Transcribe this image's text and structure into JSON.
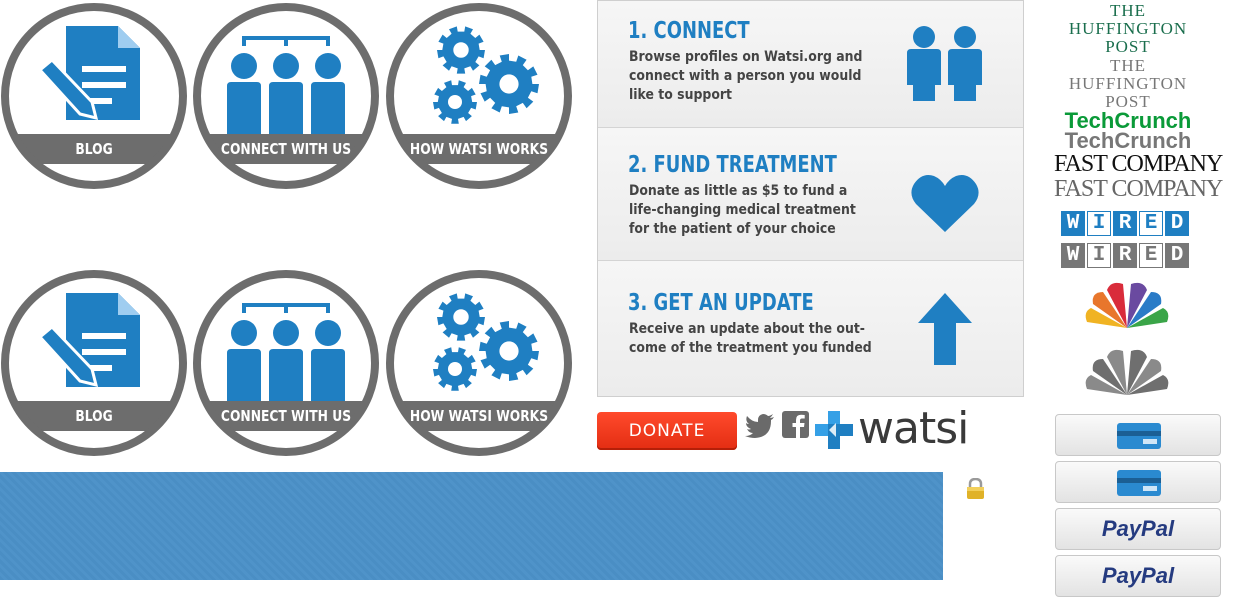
{
  "nav_circles": {
    "blog_label": "BLOG",
    "connect_label": "CONNECT WITH US",
    "how_label": "HOW WATSI WORKS"
  },
  "steps": [
    {
      "title": "1. CONNECT",
      "lines": [
        "Browse profiles on Watsi.org and",
        "connect with a person you would",
        "like to support"
      ],
      "icon": "people-icon"
    },
    {
      "title": "2. FUND TREATMENT",
      "lines": [
        "Donate as little as $5 to fund a",
        "life-changing medical treatment",
        "for the patient of your choice"
      ],
      "icon": "heart-icon"
    },
    {
      "title": "3. GET AN UPDATE",
      "lines": [
        "Receive an update about the out-",
        "come of the treatment you funded"
      ],
      "icon": "arrow-up-icon"
    }
  ],
  "donate_label": "DONATE",
  "brand": "watsi",
  "press": {
    "huffington_lines": [
      "THE",
      "HUFFINGTON",
      "POST"
    ],
    "techcrunch": "TechCrunch",
    "fastcompany": "FAST COMPANY",
    "wired_letters": [
      "W",
      "I",
      "R",
      "E",
      "D"
    ]
  },
  "payment": {
    "paypal": "PayPal"
  },
  "colors": {
    "watsi_blue": "#1f7fc2",
    "circle_gray": "#6d6d6d",
    "donate_red": "#ef3a1d",
    "banner_blue": "#4a8ec4",
    "huff_green": "#1a6e4d",
    "techcrunch_green": "#0a9a38",
    "wired_blue": "#1f7fc2",
    "paypal_dark": "#253b80",
    "paypal_light": "#179bd7"
  }
}
